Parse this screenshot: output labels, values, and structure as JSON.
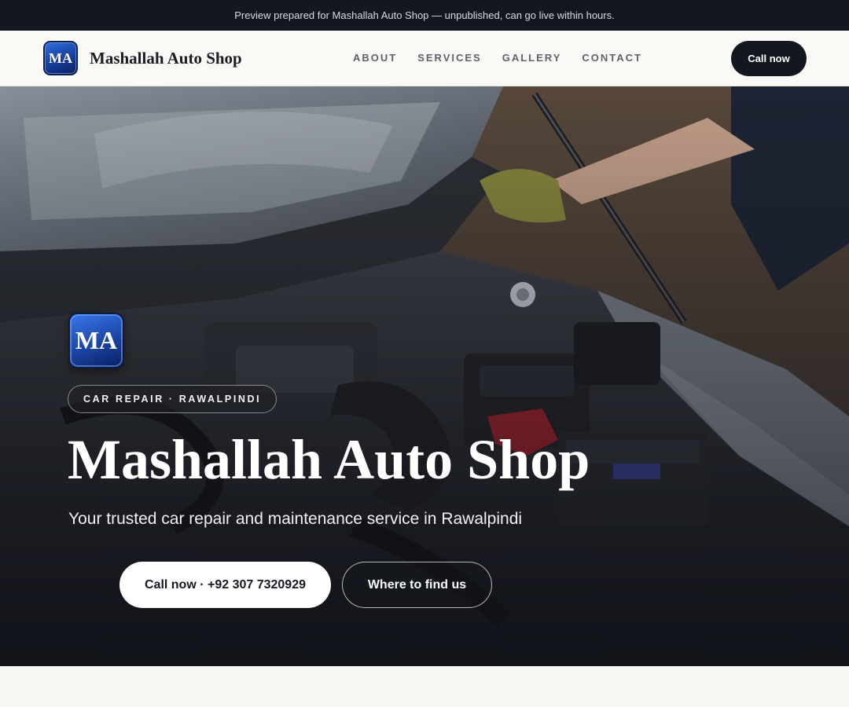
{
  "announcement": "Preview prepared for Mashallah Auto Shop — unpublished, can go live within hours.",
  "header": {
    "logo_text": "MA",
    "brand_name": "Mashallah Auto Shop",
    "nav": [
      "ABOUT",
      "SERVICES",
      "GALLERY",
      "CONTACT"
    ],
    "cta_label": "Call now"
  },
  "hero": {
    "logo_text": "MA",
    "tag": "CAR REPAIR · RAWALPINDI",
    "title": "Mashallah Auto Shop",
    "subtitle": "Your trusted car repair and maintenance service in Rawalpindi",
    "primary_button": "Call now · +92 307 7320929",
    "secondary_button": "Where to find us",
    "background_image": "car-engine-bay-photo"
  },
  "colors": {
    "dark": "#131720",
    "logo_blue": "#1a45a6",
    "page_bg": "#f8f7f4"
  }
}
